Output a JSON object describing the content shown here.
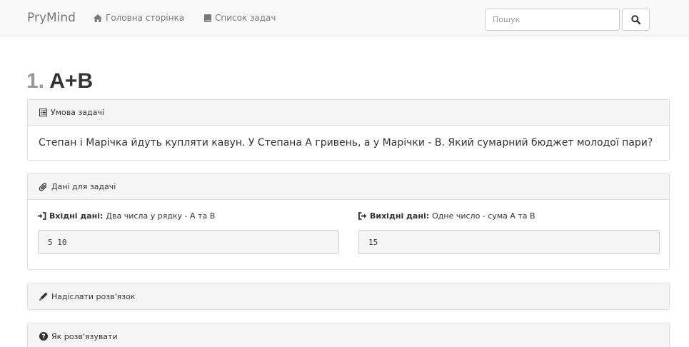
{
  "navbar": {
    "brand": "PryMind",
    "home_label": "Головна сторінка",
    "tasks_label": "Список задач",
    "search_placeholder": "Пошук"
  },
  "problem": {
    "number": "1.",
    "title": "A+B"
  },
  "condition": {
    "heading": "Умова задачі",
    "text": "Степан і Марічка йдуть купляти кавун. У Степана А гривень, а у Марічки - B. Який сумарний бюджет молодої пари?"
  },
  "data_panel": {
    "heading": "Дані для задачі",
    "input_label": "Вхідні дані:",
    "input_desc": "Два числа у рядку - А та В",
    "input_example": "5 10",
    "output_label": "Вихідні дані:",
    "output_desc": "Одне число - сума А та В",
    "output_example": "15"
  },
  "submit_panel": {
    "heading": "Надіслати розв'язок"
  },
  "howto_panel": {
    "heading": "Як розв'язувати"
  },
  "icons": {
    "home": "home-icon",
    "tasks": "book-icon",
    "search": "search-icon",
    "condition": "list-icon",
    "data": "paperclip-icon",
    "input": "sign-in-icon",
    "output": "sign-out-icon",
    "submit": "pencil-icon",
    "howto": "question-circle-icon"
  }
}
